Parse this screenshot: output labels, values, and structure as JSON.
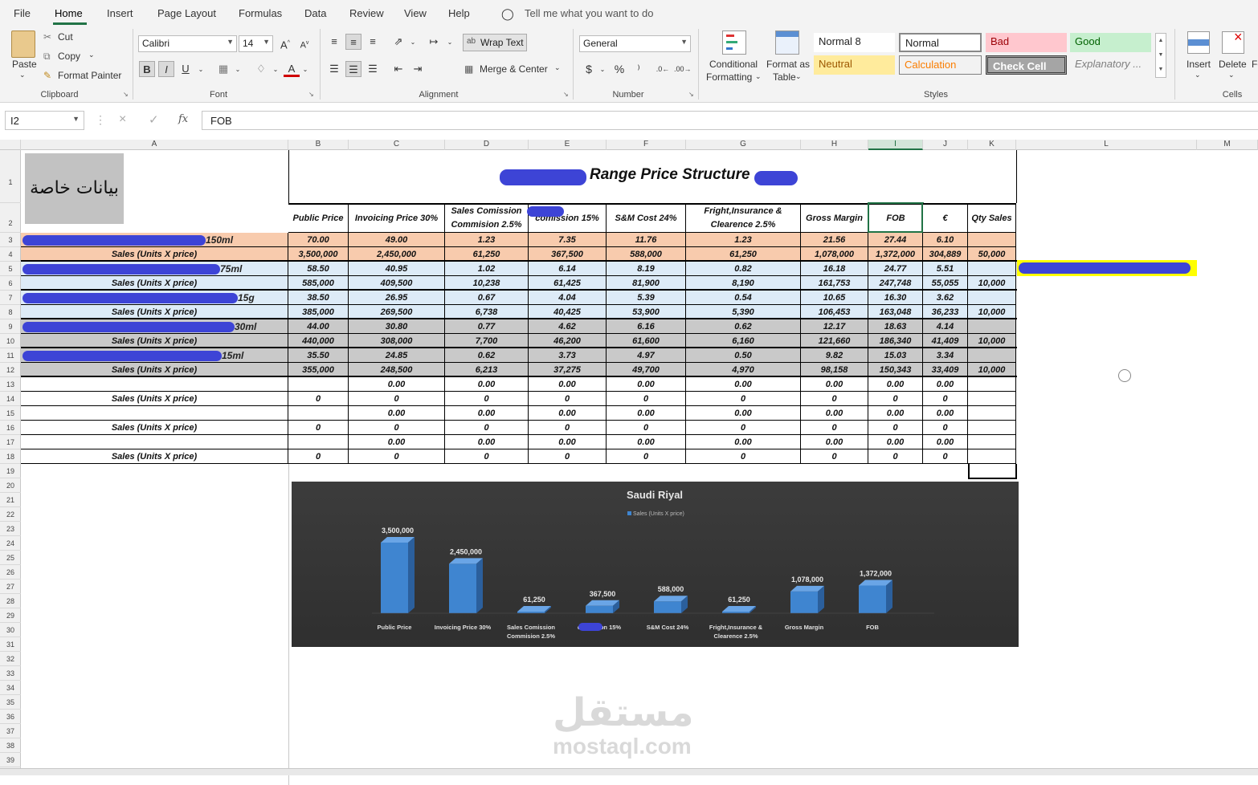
{
  "tabs": [
    "File",
    "Home",
    "Insert",
    "Page Layout",
    "Formulas",
    "Data",
    "Review",
    "View",
    "Help"
  ],
  "tell_me": "Tell me what you want to do",
  "clipboard": {
    "paste": "Paste",
    "cut": "Cut",
    "copy": "Copy",
    "format_painter": "Format Painter",
    "group": "Clipboard"
  },
  "font": {
    "name": "Calibri",
    "size": "14",
    "group": "Font"
  },
  "alignment": {
    "wrap_text": "Wrap Text",
    "merge_center": "Merge & Center",
    "group": "Alignment"
  },
  "number": {
    "format": "General",
    "currency": "$",
    "percent": "%",
    "comma": "⁾",
    "group": "Number"
  },
  "styles": {
    "conditional": "Conditional",
    "conditional2": "Formatting",
    "format_as": "Format as",
    "format_as2": "Table",
    "cells": [
      "Normal 8",
      "Normal",
      "Bad",
      "Good",
      "Neutral",
      "Calculation",
      "Check Cell",
      "Explanatory ..."
    ],
    "group": "Styles"
  },
  "cells_group": {
    "insert": "Insert",
    "delete": "Delete",
    "format": "Fo",
    "group": "Cells"
  },
  "formula_bar": {
    "name_box": "I2",
    "value": "FOB"
  },
  "columns": [
    "A",
    "B",
    "C",
    "D",
    "E",
    "F",
    "G",
    "H",
    "I",
    "J",
    "K",
    "L",
    "M"
  ],
  "rows": [
    "1",
    "2",
    "3",
    "4",
    "5",
    "6",
    "7",
    "8",
    "9",
    "10",
    "11",
    "12",
    "13",
    "14",
    "15",
    "16",
    "17",
    "18",
    "19",
    "20",
    "21",
    "22",
    "23",
    "24",
    "25",
    "26",
    "27",
    "28",
    "29",
    "30",
    "31",
    "32",
    "33",
    "34",
    "35",
    "36",
    "37",
    "38",
    "39"
  ],
  "sheet": {
    "logo_text": "بيانات خاصة",
    "title": "Range Price Structure",
    "headers": [
      "Public Price",
      "Invoicing Price 30%",
      "Sales Comission Commision 2.5%",
      "comission 15%",
      "S&M Cost 24%",
      "Fright,Insurance & Clearence 2.5%",
      "Gross Margin",
      "FOB",
      "€",
      "Qty Sales"
    ],
    "sales_label": "Sales (Units X price)",
    "products": [
      {
        "size": "150ml",
        "price": [
          "70.00",
          "49.00",
          "1.23",
          "7.35",
          "11.76",
          "1.23",
          "21.56",
          "27.44",
          "6.10",
          ""
        ],
        "sales": [
          "3,500,000",
          "2,450,000",
          "61,250",
          "367,500",
          "588,000",
          "61,250",
          "1,078,000",
          "1,372,000",
          "304,889",
          "50,000"
        ]
      },
      {
        "size": "75ml",
        "price": [
          "58.50",
          "40.95",
          "1.02",
          "6.14",
          "8.19",
          "0.82",
          "16.18",
          "24.77",
          "5.51",
          ""
        ],
        "sales": [
          "585,000",
          "409,500",
          "10,238",
          "61,425",
          "81,900",
          "8,190",
          "161,753",
          "247,748",
          "55,055",
          "10,000"
        ]
      },
      {
        "size": "15g",
        "price": [
          "38.50",
          "26.95",
          "0.67",
          "4.04",
          "5.39",
          "0.54",
          "10.65",
          "16.30",
          "3.62",
          ""
        ],
        "sales": [
          "385,000",
          "269,500",
          "6,738",
          "40,425",
          "53,900",
          "5,390",
          "106,453",
          "163,048",
          "36,233",
          "10,000"
        ]
      },
      {
        "size": "30ml",
        "price": [
          "44.00",
          "30.80",
          "0.77",
          "4.62",
          "6.16",
          "0.62",
          "12.17",
          "18.63",
          "4.14",
          ""
        ],
        "sales": [
          "440,000",
          "308,000",
          "7,700",
          "46,200",
          "61,600",
          "6,160",
          "121,660",
          "186,340",
          "41,409",
          "10,000"
        ]
      },
      {
        "size": "15ml",
        "price": [
          "35.50",
          "24.85",
          "0.62",
          "3.73",
          "4.97",
          "0.50",
          "9.82",
          "15.03",
          "3.34",
          ""
        ],
        "sales": [
          "355,000",
          "248,500",
          "6,213",
          "37,275",
          "49,700",
          "4,970",
          "98,158",
          "150,343",
          "33,409",
          "10,000"
        ]
      },
      {
        "size": "",
        "price": [
          "",
          "0.00",
          "0.00",
          "0.00",
          "0.00",
          "0.00",
          "0.00",
          "0.00",
          "0.00",
          ""
        ],
        "sales": [
          "0",
          "0",
          "0",
          "0",
          "0",
          "0",
          "0",
          "0",
          "0",
          ""
        ]
      },
      {
        "size": "",
        "price": [
          "",
          "0.00",
          "0.00",
          "0.00",
          "0.00",
          "0.00",
          "0.00",
          "0.00",
          "0.00",
          ""
        ],
        "sales": [
          "0",
          "0",
          "0",
          "0",
          "0",
          "0",
          "0",
          "0",
          "0",
          ""
        ]
      },
      {
        "size": "",
        "price": [
          "",
          "0.00",
          "0.00",
          "0.00",
          "0.00",
          "0.00",
          "0.00",
          "0.00",
          "0.00",
          ""
        ],
        "sales": [
          "0",
          "0",
          "0",
          "0",
          "0",
          "0",
          "0",
          "0",
          "0",
          ""
        ]
      }
    ]
  },
  "chart_data": {
    "type": "bar",
    "title": "Saudi Riyal",
    "categories": [
      "Public Price",
      "Invoicing Price 30%",
      "Sales Comission Commision 2.5%",
      "comission 15%",
      "S&M Cost 24%",
      "Fright,Insurance & Clearence 2.5%",
      "Gross Margin",
      "FOB"
    ],
    "series": [
      {
        "name": "Sales (Units X price)",
        "values": [
          3500000,
          2450000,
          61250,
          367500,
          588000,
          61250,
          1078000,
          1372000
        ]
      }
    ],
    "value_labels": [
      "3,500,000",
      "2,450,000",
      "61,250",
      "367,500",
      "588,000",
      "61,250",
      "1,078,000",
      "1,372,000"
    ],
    "ylim": [
      0,
      3500000
    ],
    "legend": "top",
    "grid": false,
    "bar_color": "#3f85d0"
  },
  "watermark": {
    "arabic": "مستقل",
    "latin": "mostaql.com"
  },
  "colors": {
    "accent": "#217346",
    "row_orange": "#f8cbad",
    "row_blue": "#ddebf7",
    "row_gray": "#c9c9c9",
    "highlight": "#ffff00",
    "redaction": "#3d44d6"
  }
}
